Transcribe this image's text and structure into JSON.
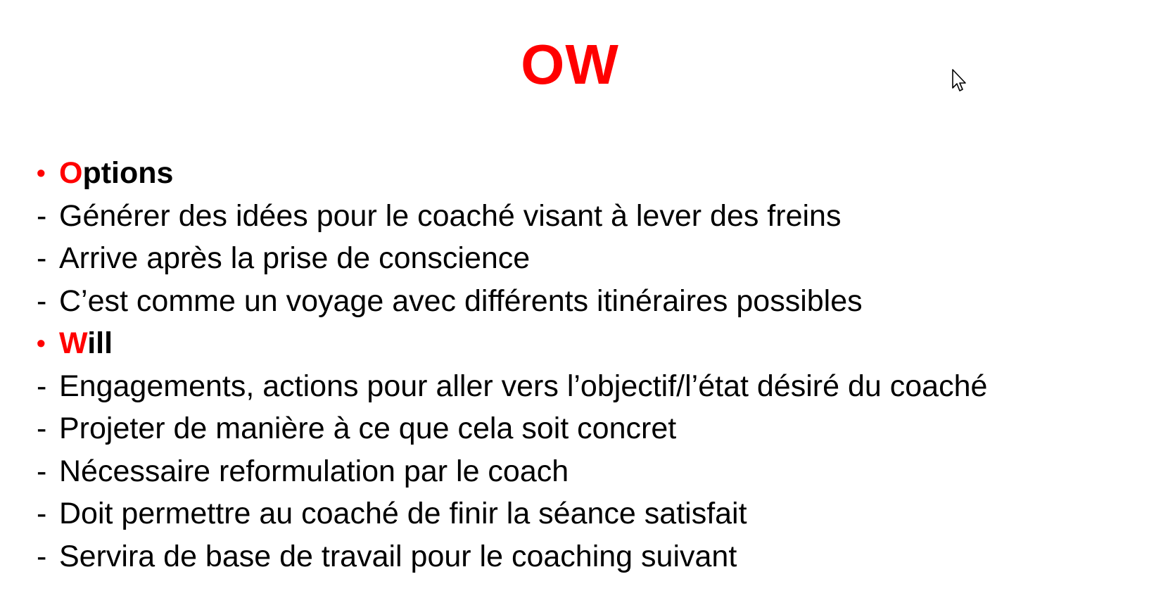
{
  "colors": {
    "accent": "#ff0000",
    "text": "#000000",
    "background": "#ffffff"
  },
  "slide": {
    "title": "OW",
    "sections": [
      {
        "bullet": "•",
        "initial": "O",
        "rest": "ptions",
        "items": [
          "Générer des idées pour le coaché visant à lever des freins",
          "Arrive après la prise de conscience",
          "C’est comme un voyage avec différents itinéraires possibles"
        ]
      },
      {
        "bullet": "•",
        "initial": "W",
        "rest": "ill",
        "items": [
          "Engagements, actions pour aller vers l’objectif/l’état désiré du coaché",
          "Projeter de manière à ce que cela soit concret",
          "Nécessaire reformulation par le coach",
          "Doit permettre au coaché de finir la séance satisfait",
          "Servira de base de travail pour le coaching suivant"
        ]
      }
    ],
    "dash": "-"
  },
  "icons": {
    "cursor": "mouse-pointer-icon"
  }
}
